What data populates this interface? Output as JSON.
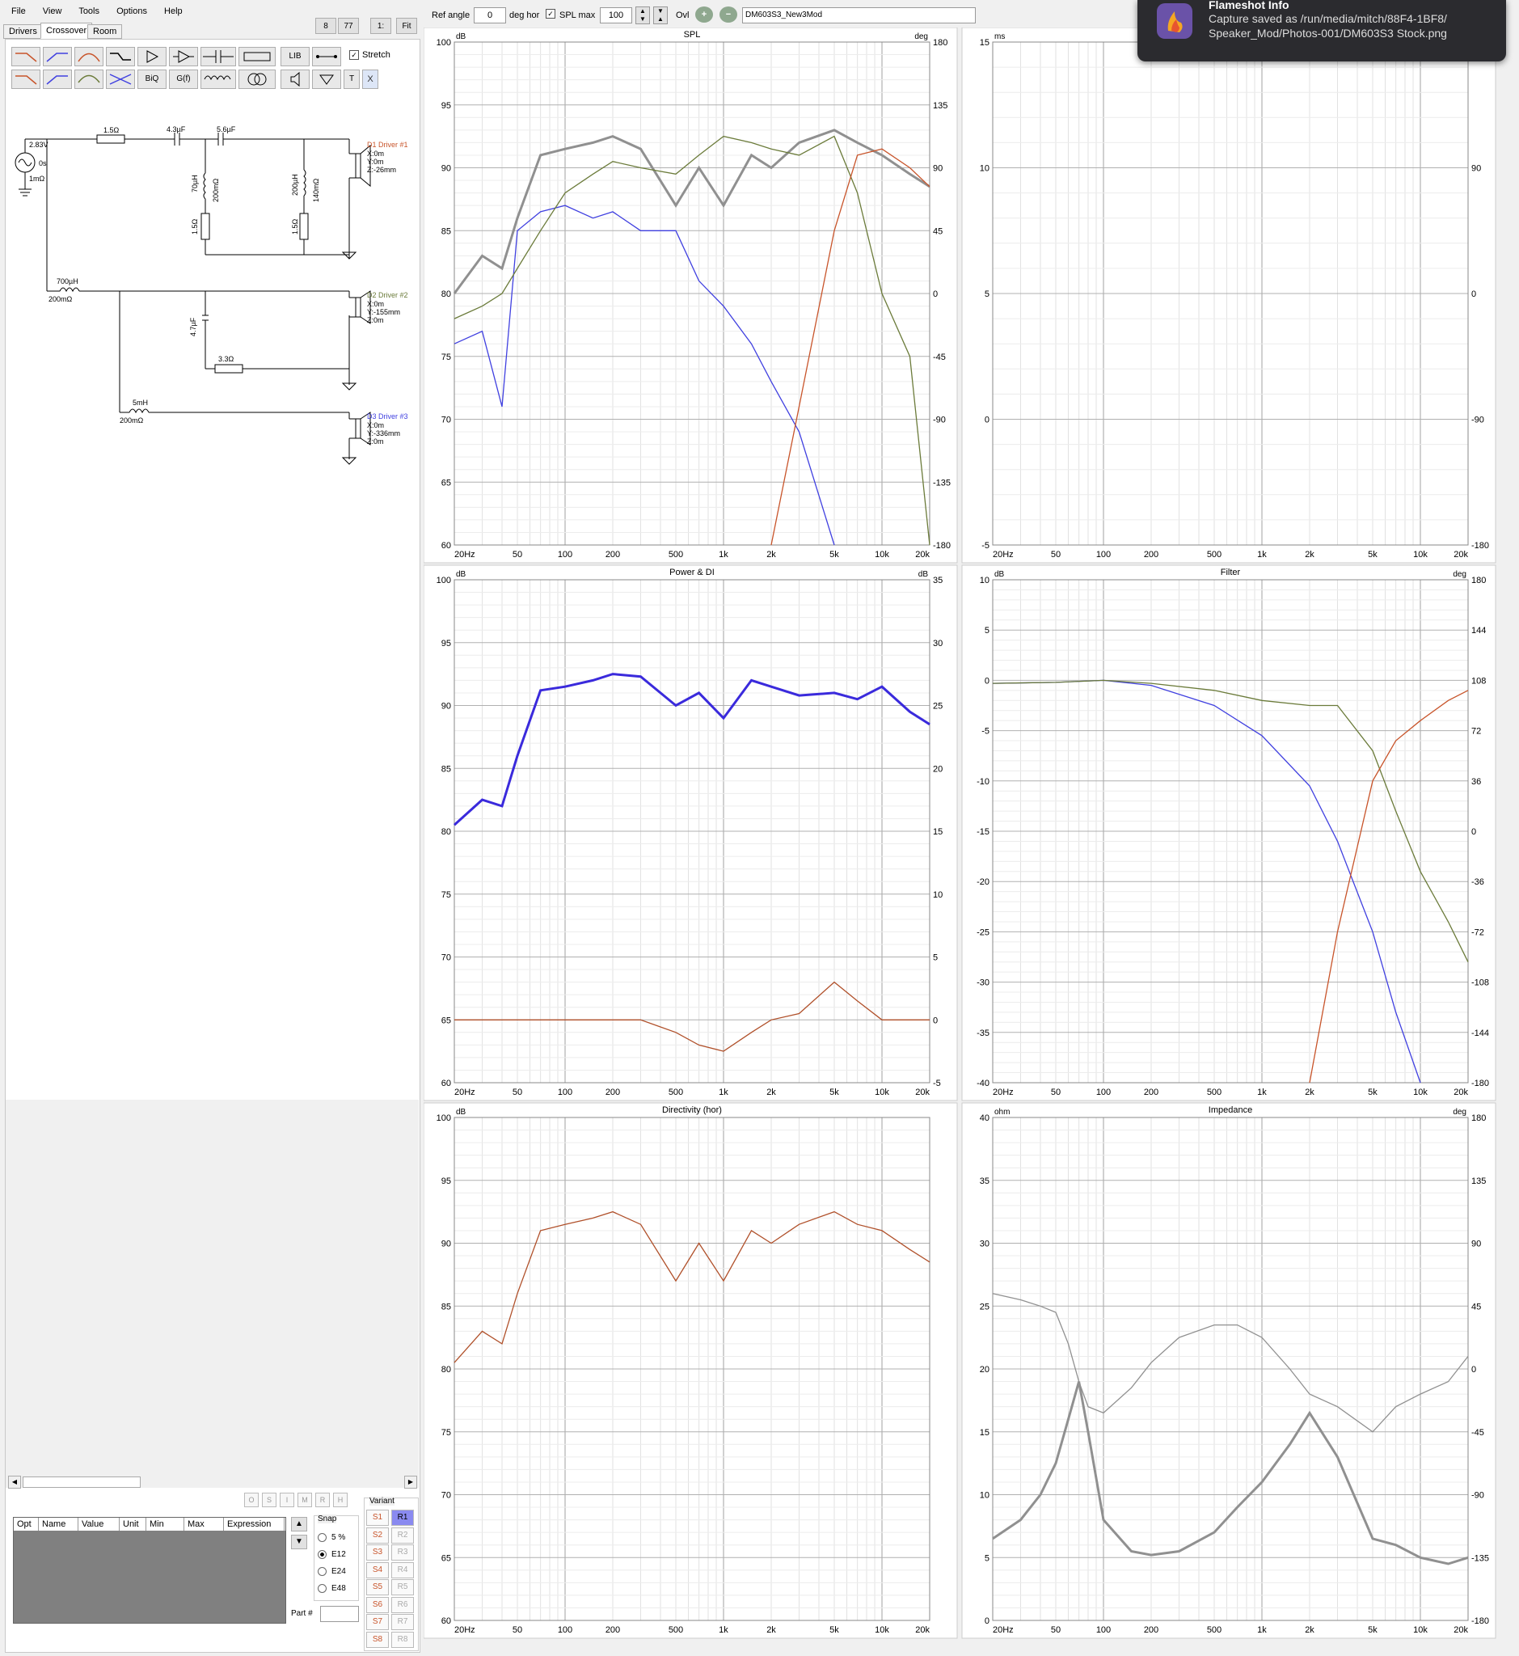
{
  "menu": [
    "File",
    "View",
    "Tools",
    "Options",
    "Help"
  ],
  "tabs": [
    "Drivers",
    "Crossover",
    "Room"
  ],
  "topbuttons": [
    "8",
    "77",
    "1:",
    "Fit"
  ],
  "toolbar": {
    "ref_angle_label": "Ref angle",
    "ref_angle_value": "0",
    "deg_hor_label": "deg hor",
    "spl_max_label": "SPL max",
    "spl_max_value": "100",
    "ovl_label": "Ovl",
    "project_name": "DM603S3_New3Mod",
    "stretch_label": "Stretch",
    "lib_label": "LIB",
    "biq_label": "BiQ",
    "gf_label": "G(f)",
    "t_label": "T",
    "x_label": "X"
  },
  "schematic": {
    "source_voltage": "2.83V",
    "source_delay": "0s",
    "source_r": "1mΩ",
    "r1": "1.5Ω",
    "c1": "4.3µF",
    "c2": "5.6µF",
    "l1": "70µH",
    "l1r": "200mΩ",
    "r2": "1.5Ω",
    "l2": "200µH",
    "l2r": "140mΩ",
    "r3": "1.5Ω",
    "d1_name": "D1 Driver #1",
    "d1_x": "X:0m",
    "d1_y": "Y:0m",
    "d1_z": "Z:-26mm",
    "l3": "700µH",
    "l3r": "200mΩ",
    "c3": "4.7µF",
    "r4": "3.3Ω",
    "d2_name": "D2 Driver #2",
    "d2_x": "X:0m",
    "d2_y": "Y:-155mm",
    "d2_z": "Z:0m",
    "l4": "5mH",
    "l4r": "200mΩ",
    "d3_name": "D3 Driver #3",
    "d3_x": "X:0m",
    "d3_y": "Y:-336mm",
    "d3_z": "Z:0m"
  },
  "optimizer": {
    "flags": [
      "O",
      "S",
      "I",
      "M",
      "R",
      "H"
    ],
    "columns": [
      "Opt",
      "Name",
      "Value",
      "Unit",
      "Min",
      "Max",
      "Expression"
    ],
    "snap_label": "Snap",
    "snap_options": [
      "5 %",
      "E12",
      "E24",
      "E48"
    ],
    "snap_selected": "E12",
    "part_label": "Part #",
    "variant_label": "Variant",
    "variants_s": [
      "S1",
      "S2",
      "S3",
      "S4",
      "S5",
      "S6",
      "S7",
      "S8"
    ],
    "variants_r": [
      "R1",
      "R2",
      "R3",
      "R4",
      "R5",
      "R6",
      "R7",
      "R8"
    ]
  },
  "notification": {
    "title": "Flameshot Info",
    "line1": "Capture saved as /run/media/mitch/88F4-1BF8/",
    "line2": "Speaker_Mod/Photos-001/DM603S3 Stock.png"
  },
  "colors": {
    "woofer": "#4040e0",
    "mid": "#6b7b3a",
    "tweeter": "#c8542a",
    "sum": "#909090",
    "power": "#3a2adc",
    "di": "#b0502a"
  },
  "x_ticks": [
    "20Hz",
    "50",
    "100",
    "200",
    "500",
    "1k",
    "2k",
    "5k",
    "10k",
    "20k"
  ],
  "charts": {
    "spl": {
      "title": "SPL",
      "left_unit": "dB",
      "right_unit": "deg",
      "left": [
        "100",
        "95",
        "90",
        "85",
        "80",
        "75",
        "70",
        "65",
        "60"
      ],
      "right": [
        "180",
        "135",
        "90",
        "45",
        "0",
        "-45",
        "-90",
        "-135",
        "-180"
      ]
    },
    "phase": {
      "title": "",
      "left_unit": "ms",
      "right_unit": "",
      "left": [
        "15",
        "10",
        "5",
        "0",
        "-5"
      ],
      "right": [
        "",
        "90",
        "0",
        "-90",
        "-180"
      ]
    },
    "power": {
      "title": "Power & DI",
      "left_unit": "dB",
      "right_unit": "dB",
      "left": [
        "100",
        "95",
        "90",
        "85",
        "80",
        "75",
        "70",
        "65",
        "60"
      ],
      "right": [
        "35",
        "30",
        "25",
        "20",
        "15",
        "10",
        "5",
        "0",
        "-5"
      ]
    },
    "filter": {
      "title": "Filter",
      "left_unit": "dB",
      "right_unit": "deg",
      "left": [
        "10",
        "5",
        "0",
        "-5",
        "-10",
        "-15",
        "-20",
        "-25",
        "-30",
        "-35",
        "-40"
      ],
      "right": [
        "180",
        "144",
        "108",
        "72",
        "36",
        "0",
        "-36",
        "-72",
        "-108",
        "-144",
        "-180"
      ]
    },
    "directivity": {
      "title": "Directivity (hor)",
      "left_unit": "dB",
      "right_unit": "",
      "left": [
        "100",
        "95",
        "90",
        "85",
        "80",
        "75",
        "70",
        "65",
        "60"
      ],
      "right": []
    },
    "impedance": {
      "title": "Impedance",
      "left_unit": "ohm",
      "right_unit": "deg",
      "left": [
        "40",
        "35",
        "30",
        "25",
        "20",
        "15",
        "10",
        "5",
        "0"
      ],
      "right": [
        "180",
        "135",
        "90",
        "45",
        "0",
        "-45",
        "-90",
        "-135",
        "-180"
      ]
    }
  },
  "chart_data": [
    {
      "type": "line",
      "title": "SPL",
      "xlabel": "",
      "ylabel": "dB",
      "x_scale": "log",
      "xlim": [
        20,
        20000
      ],
      "ylim": [
        60,
        100
      ],
      "x": [
        20,
        30,
        40,
        50,
        70,
        100,
        150,
        200,
        300,
        500,
        700,
        1000,
        1500,
        2000,
        3000,
        5000,
        7000,
        10000,
        15000,
        20000
      ],
      "series": [
        {
          "values": [
            80,
            83,
            82,
            86,
            91,
            91.5,
            92,
            92.5,
            91.5,
            87,
            90,
            87,
            91,
            90,
            92,
            93,
            92,
            91,
            89.5,
            88.5
          ]
        },
        {
          "values": [
            76,
            77,
            71,
            85,
            86.5,
            87,
            86,
            86.5,
            85,
            85,
            81,
            79,
            76,
            73,
            69,
            60,
            null,
            null,
            null,
            null
          ]
        },
        {
          "values": [
            78,
            79,
            80,
            82,
            85,
            88,
            89.5,
            90.5,
            90,
            89.5,
            91,
            92.5,
            92,
            91.5,
            91,
            92.5,
            88,
            80,
            75,
            60
          ]
        },
        {
          "values": [
            null,
            null,
            null,
            null,
            null,
            null,
            null,
            null,
            null,
            null,
            null,
            null,
            null,
            60,
            71,
            85,
            91,
            91.5,
            90,
            88.5
          ]
        }
      ]
    },
    {
      "type": "line",
      "title": "Power & DI",
      "xlabel": "",
      "ylabel": "dB",
      "x_scale": "log",
      "xlim": [
        20,
        20000
      ],
      "ylim": [
        60,
        100
      ],
      "x": [
        20,
        30,
        40,
        50,
        70,
        100,
        150,
        200,
        300,
        500,
        700,
        1000,
        1500,
        2000,
        3000,
        5000,
        7000,
        10000,
        15000,
        20000
      ],
      "series": [
        {
          "values": [
            80.5,
            82.5,
            82,
            86,
            91.2,
            91.5,
            92,
            92.5,
            92.3,
            90,
            91,
            89,
            92,
            91.5,
            90.8,
            91,
            90.5,
            91.5,
            89.5,
            88.5
          ]
        },
        {
          "values": [
            65,
            65,
            65,
            65,
            65,
            65,
            65,
            65,
            65,
            64,
            63,
            62.5,
            64,
            65,
            65.5,
            68,
            66.5,
            65,
            65,
            65
          ]
        }
      ]
    },
    {
      "type": "line",
      "title": "Filter",
      "xlabel": "",
      "ylabel": "dB",
      "x_scale": "log",
      "xlim": [
        20,
        20000
      ],
      "ylim": [
        -40,
        10
      ],
      "x": [
        20,
        50,
        100,
        200,
        500,
        1000,
        2000,
        3000,
        5000,
        7000,
        10000,
        15000,
        20000
      ],
      "series": [
        {
          "values": [
            -0.3,
            -0.2,
            0,
            -0.5,
            -2.5,
            -5.5,
            -10.5,
            -16,
            -25,
            -33,
            -40,
            null,
            null
          ]
        },
        {
          "values": [
            -0.3,
            -0.2,
            0,
            -0.3,
            -1,
            -2,
            -2.5,
            -2.5,
            -7,
            -13,
            -19,
            -24,
            -28
          ]
        },
        {
          "values": [
            null,
            null,
            null,
            null,
            null,
            null,
            -40,
            -25,
            -10,
            -6,
            -4,
            -2,
            -1
          ]
        }
      ]
    },
    {
      "type": "line",
      "title": "Directivity (hor)",
      "xlabel": "",
      "ylabel": "dB",
      "x_scale": "log",
      "xlim": [
        20,
        20000
      ],
      "ylim": [
        60,
        100
      ],
      "x": [
        20,
        30,
        40,
        50,
        70,
        100,
        150,
        200,
        300,
        500,
        700,
        1000,
        1500,
        2000,
        3000,
        5000,
        7000,
        10000,
        15000,
        20000
      ],
      "series": [
        {
          "values": [
            80.5,
            83,
            82,
            86,
            91,
            91.5,
            92,
            92.5,
            91.5,
            87,
            90,
            87,
            91,
            90,
            91.5,
            92.5,
            91.5,
            91,
            89.5,
            88.5
          ]
        }
      ]
    },
    {
      "type": "line",
      "title": "Impedance",
      "xlabel": "",
      "ylabel": "ohm",
      "x_scale": "log",
      "xlim": [
        20,
        20000
      ],
      "ylim": [
        0,
        40
      ],
      "x": [
        20,
        30,
        40,
        50,
        60,
        70,
        80,
        100,
        150,
        200,
        300,
        500,
        700,
        1000,
        1500,
        2000,
        3000,
        5000,
        7000,
        10000,
        15000,
        20000
      ],
      "series": [
        {
          "values": [
            6.5,
            8,
            10,
            12.5,
            16,
            19,
            15,
            8,
            5.5,
            5.2,
            5.5,
            7,
            9,
            11,
            14,
            16.5,
            13,
            6.5,
            6,
            5,
            4.5,
            5
          ]
        },
        {
          "values": [
            26,
            25.5,
            25,
            24.5,
            22,
            19,
            17,
            16.5,
            18.5,
            20.5,
            22.5,
            23.5,
            23.5,
            22.5,
            20,
            18,
            17,
            15,
            17,
            18,
            19,
            21
          ]
        }
      ]
    }
  ]
}
